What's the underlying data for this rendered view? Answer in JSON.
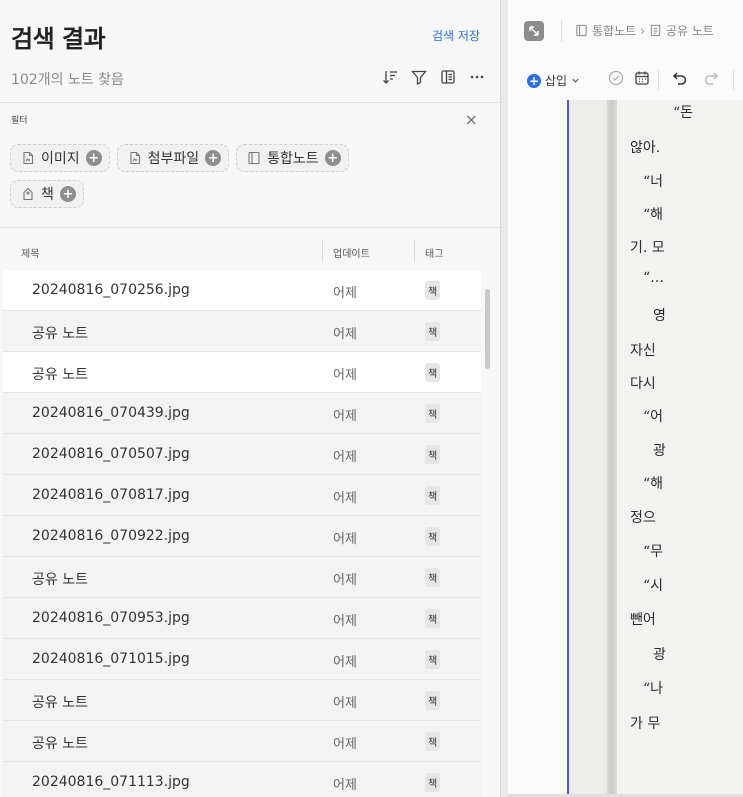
{
  "header": {
    "title": "검색 결과",
    "save_search": "검색 저장",
    "count_text": "102개의 노트 찾음"
  },
  "filter": {
    "label": "필터",
    "close": "×",
    "chips": [
      {
        "label": "이미지",
        "icon": "image-icon"
      },
      {
        "label": "첨부파일",
        "icon": "attachment-icon"
      },
      {
        "label": "통합노트",
        "icon": "notebook-stack-icon"
      },
      {
        "label": "책",
        "icon": "tag-icon"
      }
    ]
  },
  "table": {
    "columns": [
      "제목",
      "업데이트",
      "태그"
    ],
    "rows": [
      {
        "name": "20240816_070256.jpg",
        "date": "어제",
        "tag": "책",
        "highlight": true
      },
      {
        "name": "공유 노트",
        "date": "어제",
        "tag": "책",
        "highlight": false
      },
      {
        "name": "공유 노트",
        "date": "어제",
        "tag": "책",
        "highlight": true
      },
      {
        "name": "20240816_070439.jpg",
        "date": "어제",
        "tag": "책",
        "highlight": false
      },
      {
        "name": "20240816_070507.jpg",
        "date": "어제",
        "tag": "책",
        "highlight": false
      },
      {
        "name": "20240816_070817.jpg",
        "date": "어제",
        "tag": "책",
        "highlight": false
      },
      {
        "name": "20240816_070922.jpg",
        "date": "어제",
        "tag": "책",
        "highlight": false
      },
      {
        "name": "공유 노트",
        "date": "어제",
        "tag": "책",
        "highlight": false
      },
      {
        "name": "20240816_070953.jpg",
        "date": "어제",
        "tag": "책",
        "highlight": false
      },
      {
        "name": "20240816_071015.jpg",
        "date": "어제",
        "tag": "책",
        "highlight": false
      },
      {
        "name": "공유 노트",
        "date": "어제",
        "tag": "책",
        "highlight": false
      },
      {
        "name": "공유 노트",
        "date": "어제",
        "tag": "책",
        "highlight": false
      },
      {
        "name": "20240816_071113.jpg",
        "date": "어제",
        "tag": "책",
        "highlight": false
      }
    ]
  },
  "editor": {
    "breadcrumb": [
      "통합노트",
      "공유 노트"
    ],
    "breadcrumb_sep": "›",
    "insert_label": "삽입",
    "book_lines": [
      "“돈",
      "않아.",
      "“너",
      "“해",
      "기. 모",
      "“…",
      "영",
      "자신",
      "다시",
      "“어",
      "광",
      "“해",
      "정으",
      "“무",
      "“시",
      "뺀어",
      "광",
      "“나",
      "가 무"
    ]
  },
  "colors": {
    "accent": "#2a6ef3",
    "selection_border": "#5a4ff0"
  }
}
